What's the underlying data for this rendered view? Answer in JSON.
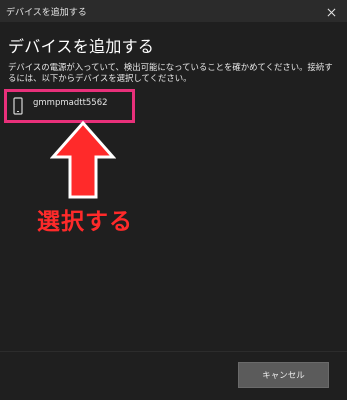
{
  "window": {
    "title": "デバイスを追加する"
  },
  "main": {
    "heading": "デバイスを追加する",
    "description": "デバイスの電源が入っていて、検出可能になっていることを確かめてください。接続するには、以下からデバイスを選択してください。"
  },
  "devices": [
    {
      "name": "gmmpmadtt5562",
      "icon": "phone-icon"
    }
  ],
  "annotation": {
    "text": "選択する",
    "color": "#ff2a2a",
    "arrow_color": "#ff2a2a",
    "highlight_color": "#e8307a"
  },
  "footer": {
    "cancel_label": "キャンセル"
  },
  "colors": {
    "background": "#1f1f1f",
    "titlebar": "#2b2b2b",
    "button": "#5b5b5b"
  }
}
